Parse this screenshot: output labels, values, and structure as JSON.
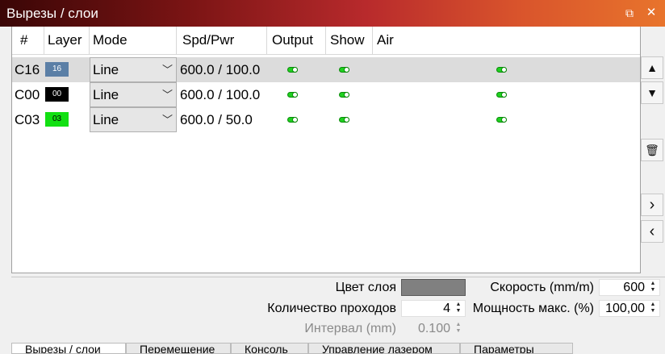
{
  "window": {
    "title": "Вырезы / слои",
    "float_glyph": "⧉",
    "close_glyph": "✕"
  },
  "table": {
    "columns": [
      "#",
      "Layer",
      "Mode",
      "Spd/Pwr",
      "Output",
      "Show",
      "Air"
    ],
    "rows": [
      {
        "id": "C16",
        "layer": "16",
        "layer_color": "#5b7fa6",
        "layer_text_color": "#ffffff",
        "mode": "Line",
        "spd_pwr": "600.0 / 100.0",
        "output": true,
        "show": true,
        "air": true,
        "selected": true
      },
      {
        "id": "C00",
        "layer": "00",
        "layer_color": "#000000",
        "layer_text_color": "#ffffff",
        "mode": "Line",
        "spd_pwr": "600.0 / 100.0",
        "output": true,
        "show": true,
        "air": true,
        "selected": false
      },
      {
        "id": "C03",
        "layer": "03",
        "layer_color": "#12e012",
        "layer_text_color": "#000000",
        "mode": "Line",
        "spd_pwr": "600.0 / 50.0",
        "output": true,
        "show": true,
        "air": true,
        "selected": false
      }
    ]
  },
  "side_buttons": {
    "move_up": "▲",
    "move_down": "▼",
    "delete": "🗑",
    "expand_right": "›",
    "collapse_left": "‹"
  },
  "settings": {
    "layer_color_label": "Цвет слоя",
    "layer_color_value": "#808080",
    "passes_label": "Количество проходов",
    "passes_value": "4",
    "interval_label": "Интервал (mm)",
    "interval_value": "0.100",
    "speed_label": "Скорость (mm/m)",
    "speed_value": "600",
    "max_power_label": "Мощность макс. (%)",
    "max_power_value": "100,00"
  },
  "bottom_tabs": [
    "Вырезы / слои",
    "Перемещение",
    "Консоль",
    "Управление лазером",
    "Параметры"
  ]
}
